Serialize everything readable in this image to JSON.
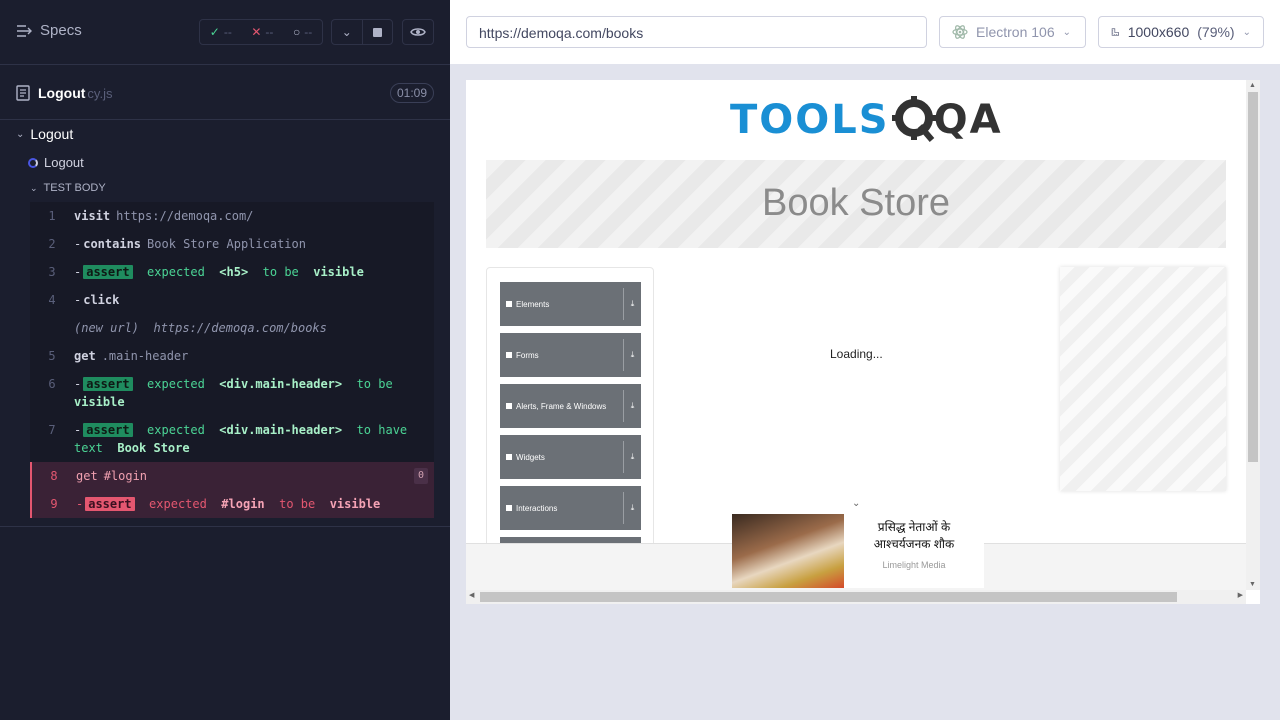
{
  "reporter": {
    "specs_label": "Specs",
    "stats": {
      "passed": "--",
      "failed": "--",
      "pending": "--"
    },
    "spec": {
      "name": "Logout",
      "ext": "cy.js",
      "duration": "01:09"
    },
    "suite": "Logout",
    "test": "Logout",
    "section": "TEST BODY",
    "commands": [
      {
        "num": "1",
        "name": "visit",
        "msg": "https://demoqa.com/"
      },
      {
        "num": "2",
        "name": "contains",
        "msg": "Book Store Application"
      },
      {
        "num": "3",
        "name": "assert",
        "parts": [
          "expected",
          "<h5>",
          "to be",
          "visible"
        ]
      },
      {
        "num": "4",
        "name": "click"
      },
      {
        "num": "",
        "newurl_label": "(new url)",
        "newurl": "https://demoqa.com/books"
      },
      {
        "num": "5",
        "name": "get",
        "msg": ".main-header"
      },
      {
        "num": "6",
        "name": "assert",
        "parts": [
          "expected",
          "<div.main-header>",
          "to be",
          "visible"
        ]
      },
      {
        "num": "7",
        "name": "assert",
        "parts": [
          "expected",
          "<div.main-header>",
          "to have text",
          "Book Store"
        ]
      },
      {
        "num": "8",
        "name": "get",
        "msg": "#login",
        "count": "0"
      },
      {
        "num": "9",
        "name": "assert",
        "parts": [
          "expected",
          "#login",
          "to be",
          "visible"
        ]
      }
    ]
  },
  "aut": {
    "url": "https://demoqa.com/books",
    "browser": "Electron 106",
    "viewport": "1000x660",
    "zoom": "(79%)"
  },
  "page": {
    "logo_a": "TOOLS",
    "logo_b": "QA",
    "banner": "Book Store",
    "nav": [
      "Elements",
      "Forms",
      "Alerts, Frame & Windows",
      "Widgets",
      "Interactions"
    ],
    "loading": "Loading...",
    "ad_title": "प्रसिद्ध नेताओं के आश्चर्यजनक शौक",
    "ad_source": "Limelight Media"
  },
  "colors": {
    "accent_pass": "#1f8c5f",
    "accent_fail": "#e45770",
    "brand_blue": "#1a8fd4"
  }
}
